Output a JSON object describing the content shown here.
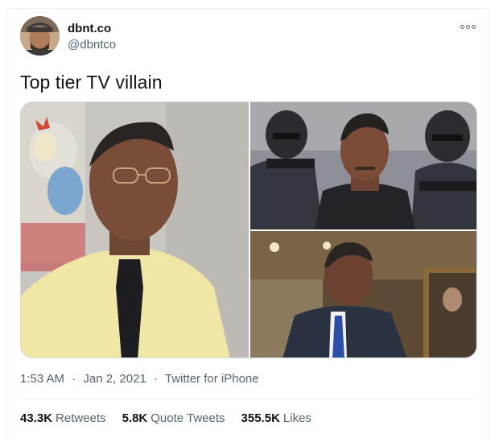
{
  "author": {
    "display_name": "dbnt.co",
    "handle": "@dbntco",
    "avatar_icon": "user-avatar"
  },
  "tweet": {
    "text": "Top tier TV villain",
    "time": "1:53 AM",
    "date": "Jan 2, 2021",
    "separator": "·",
    "source": "Twitter for iPhone"
  },
  "media": [
    {
      "description": "man-in-yellow-shirt-photo"
    },
    {
      "description": "man-with-dark-troopers-photo"
    },
    {
      "description": "man-in-suit-photo"
    }
  ],
  "stats": {
    "retweets_count": "43.3K",
    "retweets_label": "Retweets",
    "quotes_count": "5.8K",
    "quotes_label": "Quote Tweets",
    "likes_count": "355.5K",
    "likes_label": "Likes"
  },
  "colors": {
    "text_primary": "#0f1419",
    "text_secondary": "#536471",
    "border": "#eff3f4"
  }
}
